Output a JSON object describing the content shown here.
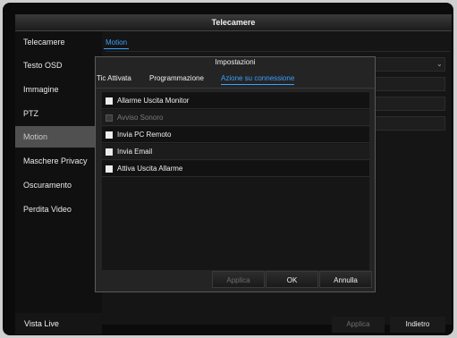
{
  "window": {
    "title": "Telecamere"
  },
  "sidebar": {
    "items": [
      {
        "label": "Telecamere",
        "active": false
      },
      {
        "label": "Testo OSD",
        "active": false
      },
      {
        "label": "Immagine",
        "active": false
      },
      {
        "label": "PTZ",
        "active": false
      },
      {
        "label": "Motion",
        "active": true
      },
      {
        "label": "Maschere Privacy",
        "active": false
      },
      {
        "label": "Oscuramento",
        "active": false
      },
      {
        "label": "Perdita Video",
        "active": false
      }
    ],
    "live_view_label": "Vista Live"
  },
  "main": {
    "tab_label": "Motion",
    "apply_label": "Applica",
    "back_label": "Indietro"
  },
  "dialog": {
    "title": "Impostazioni",
    "tabs": [
      {
        "label": "Tic Attivata",
        "active": false
      },
      {
        "label": "Programmazione",
        "active": false
      },
      {
        "label": "Azione su connessione",
        "active": true
      }
    ],
    "options": [
      {
        "label": "Allarme Uscita Monitor",
        "checked": false,
        "enabled": true
      },
      {
        "label": "Avviso Sonoro",
        "checked": false,
        "enabled": false
      },
      {
        "label": "Invia PC Remoto",
        "checked": false,
        "enabled": true
      },
      {
        "label": "Invia Email",
        "checked": false,
        "enabled": true
      },
      {
        "label": "Attiva Uscita Allarme",
        "checked": false,
        "enabled": true
      }
    ],
    "buttons": {
      "apply": "Applica",
      "ok": "OK",
      "cancel": "Annulla"
    }
  },
  "colors": {
    "accent": "#3aa0ff",
    "background": "#0b0b0b",
    "active_item": "#505050"
  }
}
